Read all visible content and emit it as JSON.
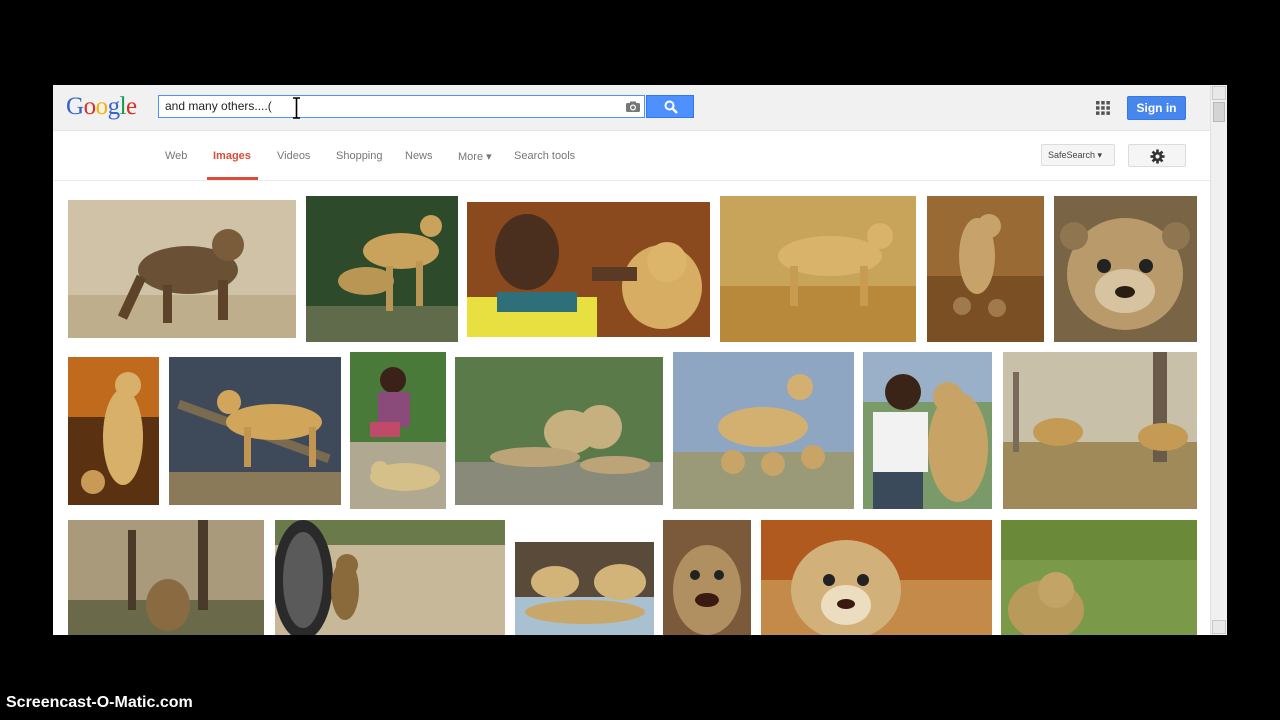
{
  "brand": {
    "letters": [
      "G",
      "o",
      "o",
      "g",
      "l",
      "e"
    ]
  },
  "search": {
    "query": "and many others....(",
    "button_icon": "magnifier-icon",
    "camera_icon": "camera-icon"
  },
  "header": {
    "apps_icon": "apps-grid-icon",
    "signin_label": "Sign in"
  },
  "nav": {
    "tabs": [
      {
        "label": "Web",
        "active": false
      },
      {
        "label": "Images",
        "active": true
      },
      {
        "label": "Videos",
        "active": false
      },
      {
        "label": "Shopping",
        "active": false
      },
      {
        "label": "News",
        "active": false
      },
      {
        "label": "More ▾",
        "active": false
      },
      {
        "label": "Search tools",
        "active": false
      }
    ],
    "safesearch_label": "SafeSearch ▾",
    "settings_icon": "gear-icon"
  },
  "results": {
    "subject": "cheetah images",
    "colors": {
      "sand": "#c9b48a",
      "fur": "#c49a52",
      "grass": "#8b9a4a",
      "sky": "#8fa6c2",
      "dark": "#3a2a1a"
    }
  },
  "watermark": "Screencast-O-Matic.com"
}
